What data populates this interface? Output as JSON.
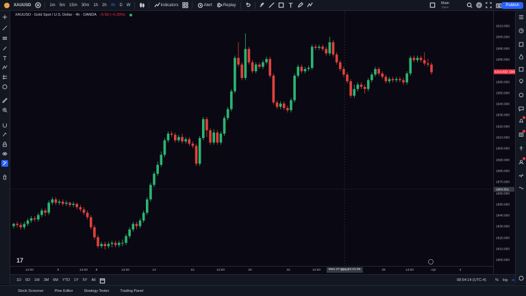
{
  "topbar": {
    "symbol": "XAUUSD",
    "intervals": [
      "1m",
      "5m",
      "15m",
      "30m",
      "1h",
      "2h",
      "4h",
      "D",
      "W"
    ],
    "active_interval": "4h",
    "indicators_label": "Indicators",
    "alert_label": "Alert",
    "replay_label": "Replay",
    "layout_name": "Main",
    "layout_sub": "Save",
    "publish_label": "Publish"
  },
  "legend": {
    "title": "XAUUSD · Gold Spot / U.S. Dollar · 4h · OANDA",
    "change": "−0.59 (−0.29%)"
  },
  "price_axis": {
    "labels": [
      "2010.000",
      "2000.000",
      "1990.000",
      "1980.000",
      "1970.000",
      "1960.000",
      "1950.000",
      "1940.000",
      "1930.000",
      "1920.000",
      "1910.000",
      "1900.000",
      "1890.000",
      "1880.000",
      "1870.000",
      "1860.000",
      "1850.000",
      "1840.000",
      "1830.000",
      "1820.000",
      "1810.000",
      "1800.000"
    ],
    "last_name": "XAUUSD",
    "last_price": "1969.310",
    "crosshair_price": "1864.501"
  },
  "time_axis": {
    "labels": [
      "13:00",
      "6",
      "13:00",
      "8",
      "13:00",
      "13",
      "15",
      "13:00",
      "20",
      "22",
      "13:00",
      "13:00",
      "29",
      "13:00",
      "Apr",
      "4"
    ],
    "crosshair_time": "Mon 27 Mar '23   01:00"
  },
  "bottom": {
    "ranges": [
      "1D",
      "5D",
      "1M",
      "3M",
      "6M",
      "YTD",
      "1Y",
      "5Y",
      "All"
    ],
    "clock": "08:54:14 (UTC-4)",
    "pct": "%",
    "log": "log",
    "auto": "auto"
  },
  "footer": {
    "tabs": [
      "Stock Screener",
      "Pine Editor",
      "Strategy Tester",
      "Trading Panel"
    ]
  },
  "colors": {
    "up": "#2bb673",
    "down": "#e0423b",
    "accent": "#2962ff",
    "background": "#0a0812"
  },
  "chart_data": {
    "type": "candlestick",
    "title": "XAUUSD · Gold Spot / U.S. Dollar · 4h · OANDA",
    "ylim": [
      1795,
      2015
    ],
    "candles": [
      [
        1831,
        1833,
        1829,
        1834
      ],
      [
        1833,
        1832,
        1830,
        1835
      ],
      [
        1832,
        1830,
        1828,
        1834
      ],
      [
        1830,
        1833,
        1828,
        1835
      ],
      [
        1833,
        1836,
        1831,
        1838
      ],
      [
        1836,
        1838,
        1834,
        1840
      ],
      [
        1838,
        1837,
        1835,
        1840
      ],
      [
        1837,
        1841,
        1835,
        1843
      ],
      [
        1841,
        1845,
        1839,
        1847
      ],
      [
        1845,
        1843,
        1840,
        1847
      ],
      [
        1843,
        1852,
        1841,
        1854
      ],
      [
        1852,
        1855,
        1850,
        1857
      ],
      [
        1855,
        1852,
        1850,
        1857
      ],
      [
        1852,
        1853,
        1850,
        1855
      ],
      [
        1853,
        1851,
        1849,
        1855
      ],
      [
        1851,
        1852,
        1849,
        1854
      ],
      [
        1852,
        1850,
        1848,
        1853
      ],
      [
        1850,
        1851,
        1848,
        1853
      ],
      [
        1851,
        1848,
        1846,
        1852
      ],
      [
        1848,
        1846,
        1844,
        1850
      ],
      [
        1846,
        1843,
        1841,
        1848
      ],
      [
        1843,
        1839,
        1837,
        1845
      ],
      [
        1839,
        1830,
        1828,
        1841
      ],
      [
        1830,
        1821,
        1819,
        1832
      ],
      [
        1821,
        1813,
        1811,
        1823
      ],
      [
        1813,
        1815,
        1811,
        1817
      ],
      [
        1815,
        1813,
        1810,
        1817
      ],
      [
        1813,
        1815,
        1811,
        1817
      ],
      [
        1815,
        1816,
        1812,
        1818
      ],
      [
        1816,
        1814,
        1812,
        1818
      ],
      [
        1814,
        1816,
        1812,
        1818
      ],
      [
        1816,
        1816,
        1813,
        1819
      ],
      [
        1816,
        1822,
        1814,
        1824
      ],
      [
        1822,
        1828,
        1820,
        1830
      ],
      [
        1828,
        1833,
        1826,
        1835
      ],
      [
        1833,
        1831,
        1828,
        1835
      ],
      [
        1831,
        1836,
        1829,
        1838
      ],
      [
        1836,
        1843,
        1834,
        1845
      ],
      [
        1843,
        1855,
        1841,
        1857
      ],
      [
        1855,
        1868,
        1853,
        1870
      ],
      [
        1868,
        1878,
        1866,
        1880
      ],
      [
        1878,
        1886,
        1876,
        1889
      ],
      [
        1886,
        1895,
        1884,
        1898
      ],
      [
        1895,
        1908,
        1893,
        1910
      ],
      [
        1908,
        1914,
        1906,
        1916
      ],
      [
        1914,
        1913,
        1911,
        1916
      ],
      [
        1913,
        1908,
        1906,
        1915
      ],
      [
        1908,
        1911,
        1906,
        1913
      ],
      [
        1911,
        1907,
        1905,
        1914
      ],
      [
        1907,
        1909,
        1905,
        1911
      ],
      [
        1909,
        1905,
        1903,
        1911
      ],
      [
        1905,
        1903,
        1901,
        1907
      ],
      [
        1903,
        1887,
        1885,
        1905
      ],
      [
        1887,
        1910,
        1885,
        1912
      ],
      [
        1910,
        1927,
        1908,
        1929
      ],
      [
        1927,
        1917,
        1911,
        1929
      ],
      [
        1917,
        1906,
        1904,
        1919
      ],
      [
        1906,
        1915,
        1904,
        1918
      ],
      [
        1915,
        1906,
        1904,
        1917
      ],
      [
        1906,
        1914,
        1904,
        1916
      ],
      [
        1914,
        1928,
        1912,
        1930
      ],
      [
        1928,
        1936,
        1926,
        1938
      ],
      [
        1936,
        1952,
        1934,
        1954
      ],
      [
        1952,
        1982,
        1950,
        1984
      ],
      [
        1982,
        1976,
        1974,
        1996
      ],
      [
        1976,
        1964,
        1962,
        1978
      ],
      [
        1964,
        1990,
        1962,
        2004
      ],
      [
        1990,
        1978,
        1976,
        1992
      ],
      [
        1978,
        1970,
        1968,
        1980
      ],
      [
        1970,
        1976,
        1968,
        1978
      ],
      [
        1976,
        1974,
        1972,
        1978
      ],
      [
        1974,
        1978,
        1972,
        1980
      ],
      [
        1978,
        1981,
        1976,
        1983
      ],
      [
        1981,
        1966,
        1964,
        1983
      ],
      [
        1966,
        1942,
        1940,
        1968
      ],
      [
        1942,
        1938,
        1936,
        1944
      ],
      [
        1938,
        1941,
        1936,
        1943
      ],
      [
        1941,
        1937,
        1935,
        1943
      ],
      [
        1937,
        1935,
        1933,
        1939
      ],
      [
        1935,
        1944,
        1933,
        1946
      ],
      [
        1944,
        1966,
        1942,
        1968
      ],
      [
        1966,
        1974,
        1964,
        1976
      ],
      [
        1974,
        1970,
        1968,
        1976
      ],
      [
        1970,
        1972,
        1968,
        1974
      ],
      [
        1972,
        1973,
        1970,
        1975
      ],
      [
        1973,
        1992,
        1971,
        1994
      ],
      [
        1992,
        1991,
        1989,
        1994
      ],
      [
        1991,
        1992,
        1989,
        1994
      ],
      [
        1992,
        1990,
        1988,
        1994
      ],
      [
        1990,
        1986,
        1984,
        1992
      ],
      [
        1986,
        1996,
        1984,
        2001
      ],
      [
        1996,
        1985,
        1983,
        1998
      ],
      [
        1985,
        1978,
        1976,
        1987
      ],
      [
        1978,
        1972,
        1970,
        1980
      ],
      [
        1972,
        1967,
        1965,
        1974
      ],
      [
        1967,
        1961,
        1959,
        1969
      ],
      [
        1961,
        1948,
        1946,
        1963
      ],
      [
        1948,
        1954,
        1946,
        1958
      ],
      [
        1954,
        1958,
        1952,
        1960
      ],
      [
        1958,
        1956,
        1954,
        1960
      ],
      [
        1956,
        1954,
        1950,
        1958
      ],
      [
        1954,
        1962,
        1952,
        1964
      ],
      [
        1962,
        1967,
        1960,
        1969
      ],
      [
        1967,
        1972,
        1965,
        1974
      ],
      [
        1972,
        1968,
        1966,
        1974
      ],
      [
        1968,
        1965,
        1963,
        1970
      ],
      [
        1965,
        1961,
        1959,
        1967
      ],
      [
        1961,
        1963,
        1959,
        1965
      ],
      [
        1963,
        1962,
        1960,
        1965
      ],
      [
        1962,
        1963,
        1960,
        1965
      ],
      [
        1963,
        1962,
        1960,
        1965
      ],
      [
        1962,
        1960,
        1958,
        1964
      ],
      [
        1960,
        1968,
        1958,
        1970
      ],
      [
        1968,
        1982,
        1966,
        1984
      ],
      [
        1982,
        1980,
        1978,
        1984
      ],
      [
        1980,
        1982,
        1978,
        1984
      ],
      [
        1982,
        1980,
        1978,
        1984
      ],
      [
        1980,
        1977,
        1975,
        1987
      ],
      [
        1977,
        1976,
        1974,
        1981
      ],
      [
        1976,
        1969,
        1967,
        1978
      ]
    ]
  }
}
